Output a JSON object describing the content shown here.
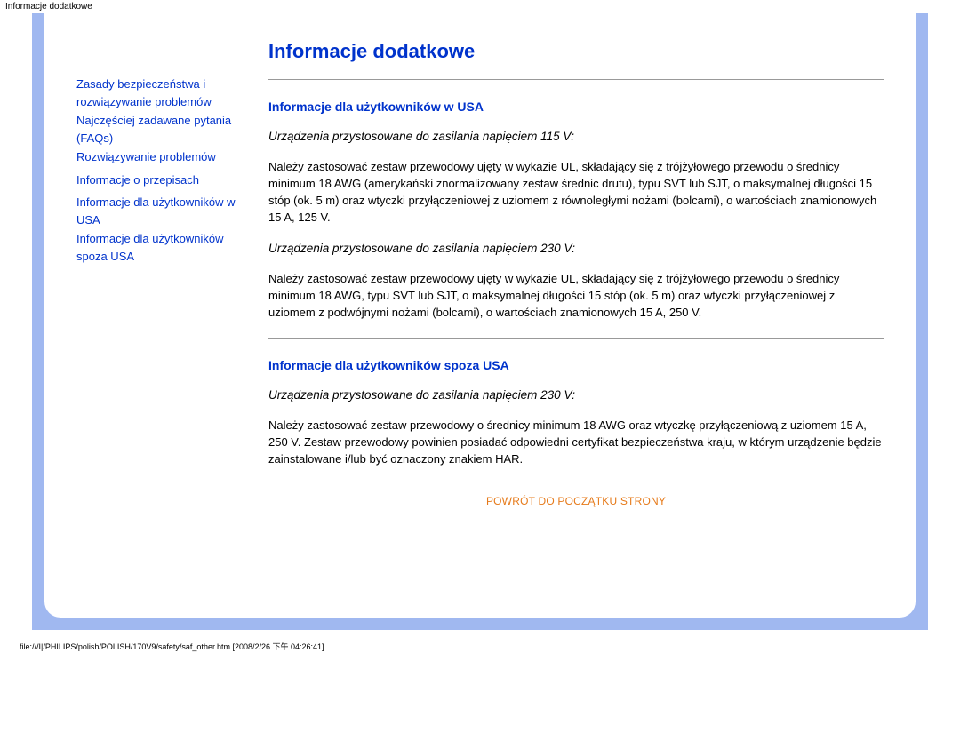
{
  "browser_title": "Informacje dodatkowe",
  "sidebar": {
    "links": [
      {
        "label": "Zasady bezpieczeństwa i rozwiązywanie problemów"
      },
      {
        "label": "Najczęściej  zadawane pytania (FAQs)"
      },
      {
        "label": "Rozwiązywanie problemów"
      },
      {
        "label": "Informacje o przepisach"
      },
      {
        "label": "Informacje dla użytkowników w USA"
      },
      {
        "label": "Informacje dla użytkowników spoza USA"
      }
    ]
  },
  "main": {
    "title": "Informacje dodatkowe",
    "section1": {
      "heading": "Informacje dla użytkowników w USA",
      "sub1": "Urządzenia przystosowane do zasilania napięciem 115 V:",
      "p1": "Należy zastosować zestaw przewodowy ujęty w wykazie UL, składający się z trójżyłowego przewodu o średnicy minimum 18 AWG (amerykański znormalizowany zestaw średnic drutu), typu SVT lub SJT, o maksymalnej długości 15 stóp (ok. 5 m) oraz wtyczki przyłączeniowej z uziomem z równoległymi nożami (bolcami), o wartościach znamionowych 15 A, 125 V.",
      "sub2": "Urządzenia przystosowane do zasilania napięciem 230 V:",
      "p2": "Należy zastosować zestaw przewodowy ujęty w wykazie UL, składający się z trójżyłowego przewodu o średnicy minimum 18 AWG, typu SVT lub SJT, o maksymalnej długości 15 stóp (ok. 5 m) oraz wtyczki przyłączeniowej z uziomem z podwójnymi nożami (bolcami), o wartościach znamionowych 15 A, 250 V."
    },
    "section2": {
      "heading": "Informacje dla użytkowników spoza USA",
      "sub1": "Urządzenia przystosowane do zasilania napięciem 230 V:",
      "p1": "Należy zastosować zestaw przewodowy o średnicy minimum 18 AWG oraz wtyczkę przyłączeniową z uziomem 15 A, 250 V. Zestaw przewodowy powinien posiadać odpowiedni certyfikat bezpieczeństwa kraju, w którym urządzenie będzie zainstalowane i/lub być oznaczony znakiem HAR."
    },
    "back_top": "POWRÓT DO POCZĄTKU STRONY"
  },
  "footer_path": "file:///I|/PHILIPS/polish/POLISH/170V9/safety/saf_other.htm [2008/2/26 下午 04:26:41]"
}
